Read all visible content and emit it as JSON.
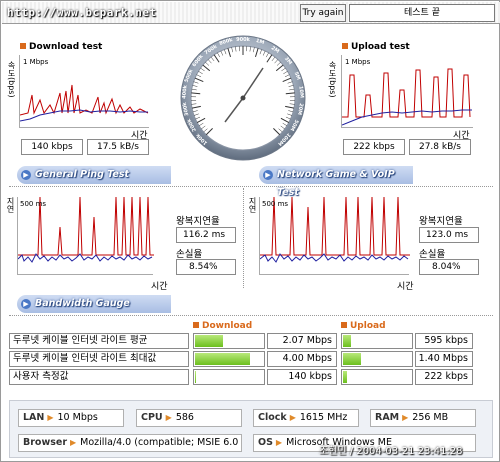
{
  "header": {
    "url": "http://www.bcpark.net",
    "try_again": "Try again",
    "status": "테스트 끝"
  },
  "download": {
    "title": "Download test",
    "ylabel": "속도(bps)",
    "scale": "1 Mbps",
    "xlabel": "시간",
    "kbps": "140 kbps",
    "kbs": "17.5 kB/s"
  },
  "upload": {
    "title": "Upload test",
    "ylabel": "속도(bps)",
    "scale": "1 Mbps",
    "xlabel": "시간",
    "kbps": "222 kbps",
    "kbs": "27.8 kB/s"
  },
  "gauge": {
    "ticks": [
      "100k",
      "200k",
      "300k",
      "400k",
      "500k",
      "600k",
      "700k",
      "800k",
      "900k",
      "1M",
      "2M",
      "3M",
      "5M",
      "10M",
      "20M",
      "50M",
      "100M"
    ]
  },
  "tabs": {
    "ping": "General Ping Test",
    "game": "Network Game & VoIP Test",
    "bandwidth": "Bandwidth Gauge"
  },
  "ping_left": {
    "ylabel": "지연",
    "scale": "500 ms",
    "xlabel": "시간",
    "delay_label": "왕복지연율",
    "delay_value": "116.2 ms",
    "loss_label": "손실율",
    "loss_value": "8.54%"
  },
  "ping_right": {
    "ylabel": "지연",
    "scale": "500 ms",
    "xlabel": "시간",
    "delay_label": "왕복지연율",
    "delay_value": "123.0 ms",
    "loss_label": "손실율",
    "loss_value": "8.04%"
  },
  "bandwidth": {
    "download_header": "Download",
    "upload_header": "Upload",
    "rows": [
      {
        "name": "두루넷 케이블 인터넷 라이트 평균",
        "down_value": "2.07 Mbps",
        "down_fill": 0.4,
        "up_value": "595 kbps",
        "up_fill": 0.12
      },
      {
        "name": "두루넷 케이블 인터넷 라이트 최대값",
        "down_value": "4.00 Mbps",
        "down_fill": 0.78,
        "up_value": "1.40 Mbps",
        "up_fill": 0.25
      },
      {
        "name": "사용자 측정값",
        "down_value": "140 kbps",
        "down_fill": 0.02,
        "up_value": "222 kbps",
        "up_fill": 0.05
      }
    ]
  },
  "system": {
    "lan_key": "LAN",
    "lan_value": "10 Mbps",
    "cpu_key": "CPU",
    "cpu_value": "586",
    "clock_key": "Clock",
    "clock_value": "1615 MHz",
    "ram_key": "RAM",
    "ram_value": "256 MB",
    "browser_key": "Browser",
    "browser_value": "Mozilla/4.0 (compatible; MSIE 6.0",
    "os_key": "OS",
    "os_value": "Microsoft Windows ME"
  },
  "stamp": "조현민 / 2004-03-21 23:41:28",
  "colors": {
    "line_red": "#c00000",
    "line_blue": "#2020a0",
    "accent_orange": "#d96a1c",
    "tab_blue": "#a8bde3",
    "bar_green": "#6cbf1e"
  }
}
